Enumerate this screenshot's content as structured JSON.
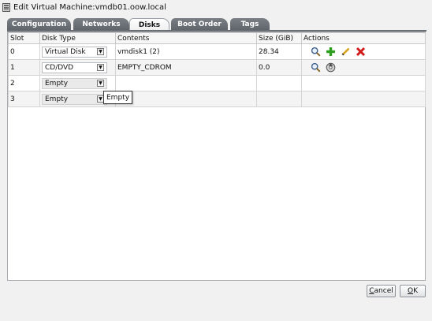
{
  "window": {
    "title": "Edit Virtual Machine:vmdb01.oow.local",
    "icon": "vm-edit-icon"
  },
  "tabs": [
    {
      "label": "Configuration",
      "active": false
    },
    {
      "label": "Networks",
      "active": false
    },
    {
      "label": "Disks",
      "active": true
    },
    {
      "label": "Boot Order",
      "active": false
    },
    {
      "label": "Tags",
      "active": false
    }
  ],
  "table": {
    "columns": [
      "Slot",
      "Disk Type",
      "Contents",
      "Size (GiB)",
      "Actions"
    ],
    "rows": [
      {
        "slot": "0",
        "disk_type": "Virtual Disk",
        "contents": "vmdisk1 (2)",
        "size": "28.34",
        "actions": [
          "search-icon",
          "add-icon",
          "edit-icon",
          "delete-icon"
        ]
      },
      {
        "slot": "1",
        "disk_type": "CD/DVD",
        "contents": "EMPTY_CDROM",
        "size": "0.0",
        "actions": [
          "search-icon",
          "eject-icon"
        ]
      },
      {
        "slot": "2",
        "disk_type": "Empty",
        "contents": "",
        "size": "",
        "actions": []
      },
      {
        "slot": "3",
        "disk_type": "Empty",
        "contents": "",
        "size": "",
        "actions": []
      }
    ]
  },
  "tooltip": {
    "text": "Empty"
  },
  "buttons": {
    "cancel_mnemonic": "C",
    "cancel_rest": "ancel",
    "ok_mnemonic": "O",
    "ok_rest": "K"
  },
  "colors": {
    "tab_inactive": "#6b7076",
    "add": "#2e9e1e",
    "delete": "#d21b1b",
    "edit": "#d9a21b"
  }
}
